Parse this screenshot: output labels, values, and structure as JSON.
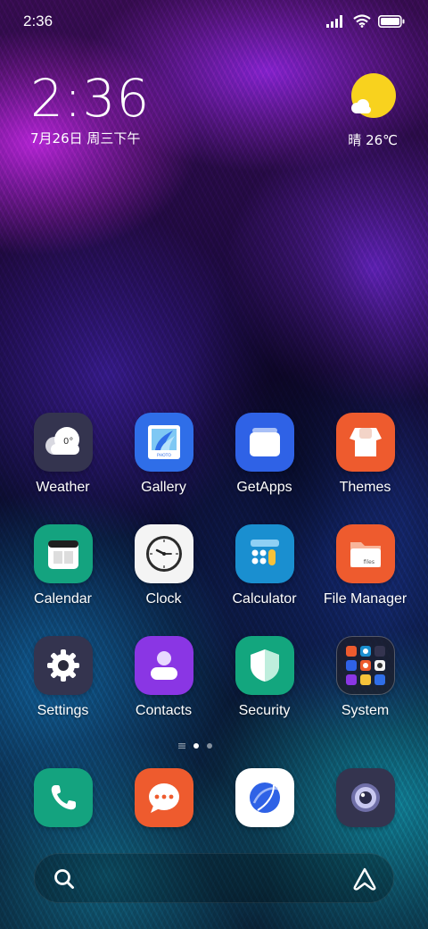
{
  "status_bar": {
    "time": "2:36"
  },
  "clock_widget": {
    "time": "2:36",
    "date": "7月26日 周三下午"
  },
  "weather_widget": {
    "condition": "晴",
    "temperature": "26℃",
    "text": "晴 26℃",
    "sun_color": "#f8d21e"
  },
  "apps": [
    {
      "label": "Weather",
      "icon": "weather-icon"
    },
    {
      "label": "Gallery",
      "icon": "gallery-icon"
    },
    {
      "label": "GetApps",
      "icon": "getapps-icon"
    },
    {
      "label": "Themes",
      "icon": "themes-icon"
    },
    {
      "label": "Calendar",
      "icon": "calendar-icon"
    },
    {
      "label": "Clock",
      "icon": "clock-icon"
    },
    {
      "label": "Calculator",
      "icon": "calculator-icon"
    },
    {
      "label": "File Manager",
      "icon": "file-manager-icon"
    },
    {
      "label": "Settings",
      "icon": "settings-icon"
    },
    {
      "label": "Contacts",
      "icon": "contacts-icon"
    },
    {
      "label": "Security",
      "icon": "security-icon"
    },
    {
      "label": "System",
      "icon": "folder-icon"
    }
  ],
  "weather_icon_text": "0°",
  "gallery_icon_text": "PHOTO",
  "files_icon_text": "files",
  "dock": [
    {
      "icon": "phone-icon"
    },
    {
      "icon": "messages-icon"
    },
    {
      "icon": "browser-icon"
    },
    {
      "icon": "camera-icon"
    }
  ],
  "page_indicator": {
    "current_page": 2,
    "total_pages": 3
  },
  "colors": {
    "weather": "#34344f",
    "gallery": "#2f6ee8",
    "getapps": "#2f62e6",
    "themes": "#ee5b2e",
    "calendar": "#14a37f",
    "clock": "#f4f4f4",
    "calculator": "#1a8fd0",
    "files": "#ee5b2e",
    "settings": "#34344f",
    "contacts": "#8a36e4",
    "security": "#13a67e",
    "phone": "#14a37f",
    "messages": "#ee5b2e",
    "browser": "#ffffff",
    "camera": "#34344f"
  }
}
